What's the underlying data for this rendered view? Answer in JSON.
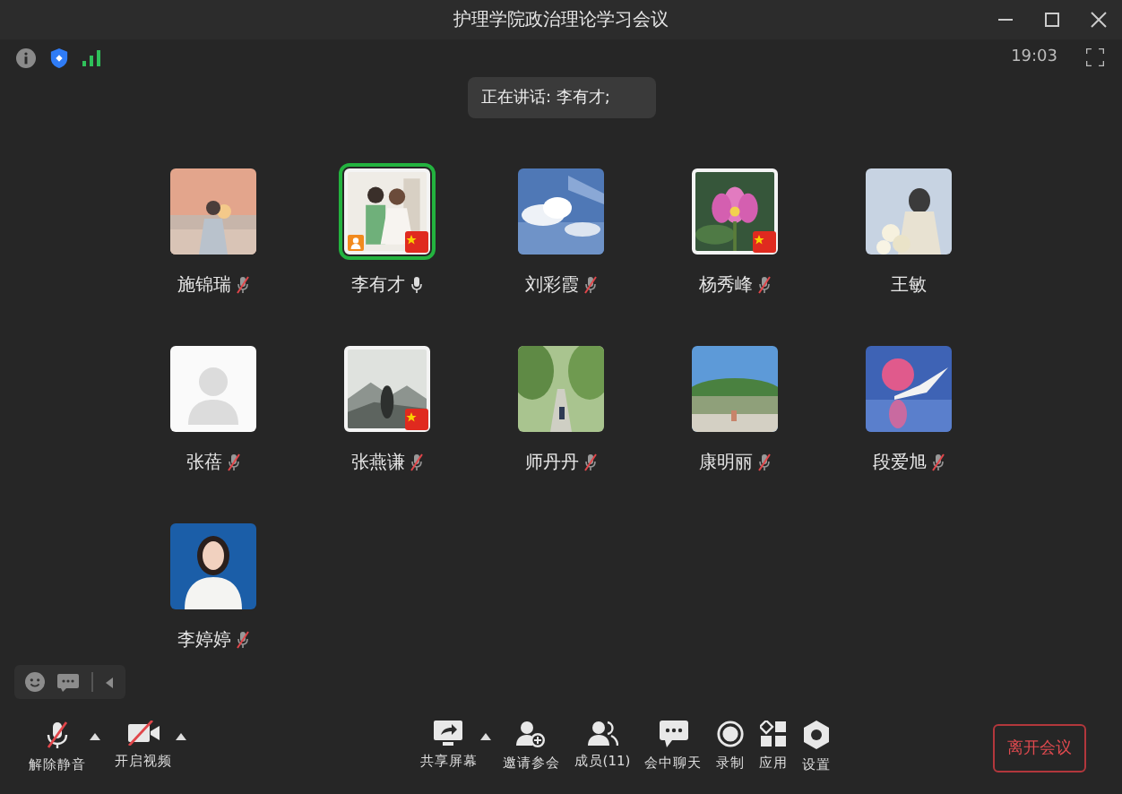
{
  "window": {
    "title": "护理学院政治理论学习会议"
  },
  "status": {
    "time": "19:03"
  },
  "speaking_banner": "正在讲话: 李有才;",
  "participants": [
    {
      "name": "施锦瑞",
      "audio": true,
      "muted": true,
      "framed": false,
      "flag": false,
      "host": false,
      "speaking": false
    },
    {
      "name": "李有才",
      "audio": true,
      "muted": false,
      "framed": true,
      "flag": true,
      "host": true,
      "speaking": true
    },
    {
      "name": "刘彩霞",
      "audio": true,
      "muted": true,
      "framed": false,
      "flag": false,
      "host": false,
      "speaking": false
    },
    {
      "name": "杨秀峰",
      "audio": true,
      "muted": true,
      "framed": true,
      "flag": true,
      "host": false,
      "speaking": false
    },
    {
      "name": "王敏",
      "audio": false,
      "muted": false,
      "framed": false,
      "flag": false,
      "host": false,
      "speaking": false
    },
    {
      "name": "张蓓",
      "audio": true,
      "muted": true,
      "framed": false,
      "flag": false,
      "host": false,
      "speaking": false
    },
    {
      "name": "张燕谦",
      "audio": true,
      "muted": true,
      "framed": true,
      "flag": true,
      "host": false,
      "speaking": false
    },
    {
      "name": "师丹丹",
      "audio": true,
      "muted": true,
      "framed": false,
      "flag": false,
      "host": false,
      "speaking": false
    },
    {
      "name": "康明丽",
      "audio": true,
      "muted": true,
      "framed": false,
      "flag": false,
      "host": false,
      "speaking": false
    },
    {
      "name": "段爱旭",
      "audio": true,
      "muted": true,
      "framed": false,
      "flag": false,
      "host": false,
      "speaking": false
    },
    {
      "name": "李婷婷",
      "audio": true,
      "muted": true,
      "framed": false,
      "flag": false,
      "host": false,
      "speaking": false
    }
  ],
  "toolbar_left": [
    {
      "kind": "mic-off",
      "label": "解除静音",
      "caret": true
    },
    {
      "kind": "video-off",
      "label": "开启视频",
      "caret": true
    }
  ],
  "toolbar_center": [
    {
      "kind": "share",
      "label": "共享屏幕",
      "caret": true
    },
    {
      "kind": "invite",
      "label": "邀请参会",
      "caret": false
    },
    {
      "kind": "members",
      "label": "成员(11)",
      "caret": false
    },
    {
      "kind": "chat",
      "label": "会中聊天",
      "caret": false
    },
    {
      "kind": "record",
      "label": "录制",
      "caret": false
    },
    {
      "kind": "apps",
      "label": "应用",
      "caret": false
    },
    {
      "kind": "settings",
      "label": "设置",
      "caret": false
    }
  ],
  "leave_button": "离开会议"
}
